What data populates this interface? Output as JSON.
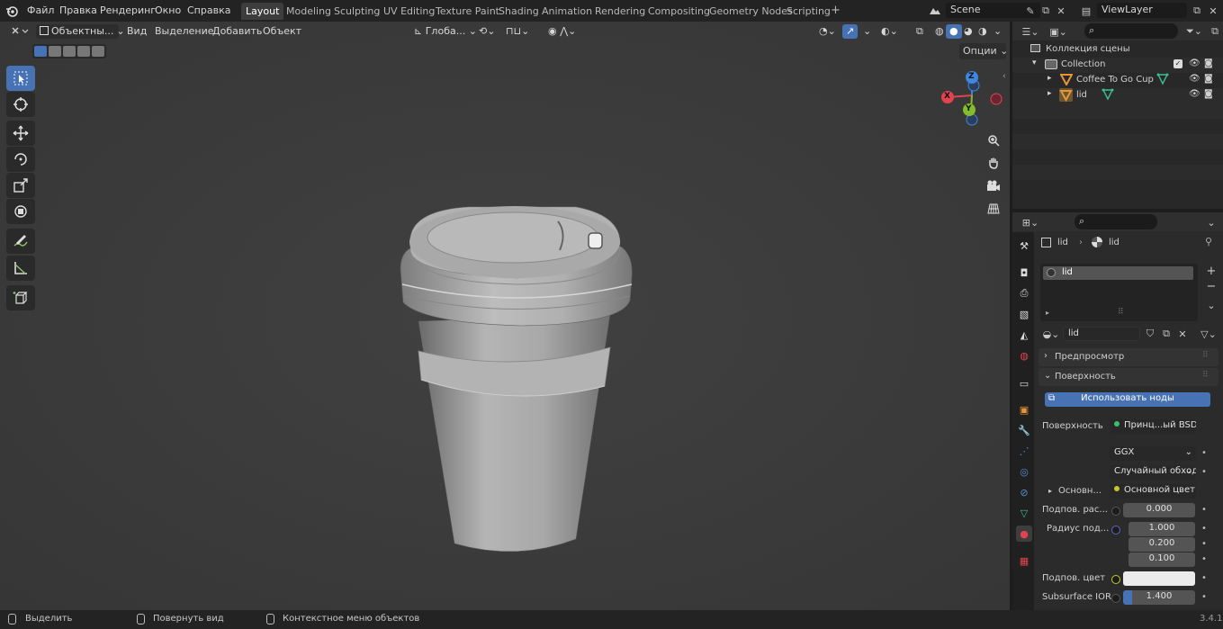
{
  "menu": {
    "file": "Файл",
    "edit": "Правка",
    "render": "Рендеринг",
    "window": "Окно",
    "help": "Справка"
  },
  "workspaces": [
    "Layout",
    "Modeling",
    "Sculpting",
    "UV Editing",
    "Texture Paint",
    "Shading",
    "Animation",
    "Rendering",
    "Compositing",
    "Geometry Nodes",
    "Scripting"
  ],
  "active_workspace": "Layout",
  "scene": {
    "name": "Scene",
    "view_layer": "ViewLayer"
  },
  "viewport": {
    "mode": "Объектны...",
    "menu_view": "Вид",
    "menu_select": "Выделение",
    "menu_add": "Добавить",
    "menu_object": "Объект",
    "transform_orientation": "Глоба...",
    "options": "Опции",
    "gizmo": {
      "x": "X",
      "y": "Y",
      "z": "Z"
    }
  },
  "outliner": {
    "scene_collection": "Коллекция сцены",
    "collection": "Collection",
    "objects": [
      {
        "name": "Coffee To Go Cup"
      },
      {
        "name": "lid"
      }
    ]
  },
  "properties": {
    "breadcrumb_object": "lid",
    "breadcrumb_material": "lid",
    "slot_name": "lid",
    "material_name": "lid",
    "panel_preview": "Предпросмотр",
    "panel_surface": "Поверхность",
    "use_nodes": "Использовать ноды",
    "surface_label": "Поверхность",
    "surface_value": "Принц...ый BSDF",
    "distribution": "GGX",
    "subsurface_method": "Случайный обход",
    "base_color_label": "Основн...",
    "base_color_value": "Основной цвет",
    "subsurface_label": "Подпов. рас...",
    "subsurface_value": "0.000",
    "radius_label": "Радиус под...",
    "radius_values": [
      "1.000",
      "0.200",
      "0.100"
    ],
    "subsurface_color_label": "Подпов. цвет",
    "ior_label": "Subsurface IOR",
    "ior_value": "1.400"
  },
  "status": {
    "select": "Выделить",
    "rotate": "Повернуть вид",
    "context": "Контекстное меню объектов",
    "version": "3.4.1"
  },
  "colors": {
    "accent": "#4772b3",
    "x_axis": "#e2444f",
    "y_axis": "#84bc2a",
    "z_axis": "#3d87e0"
  }
}
